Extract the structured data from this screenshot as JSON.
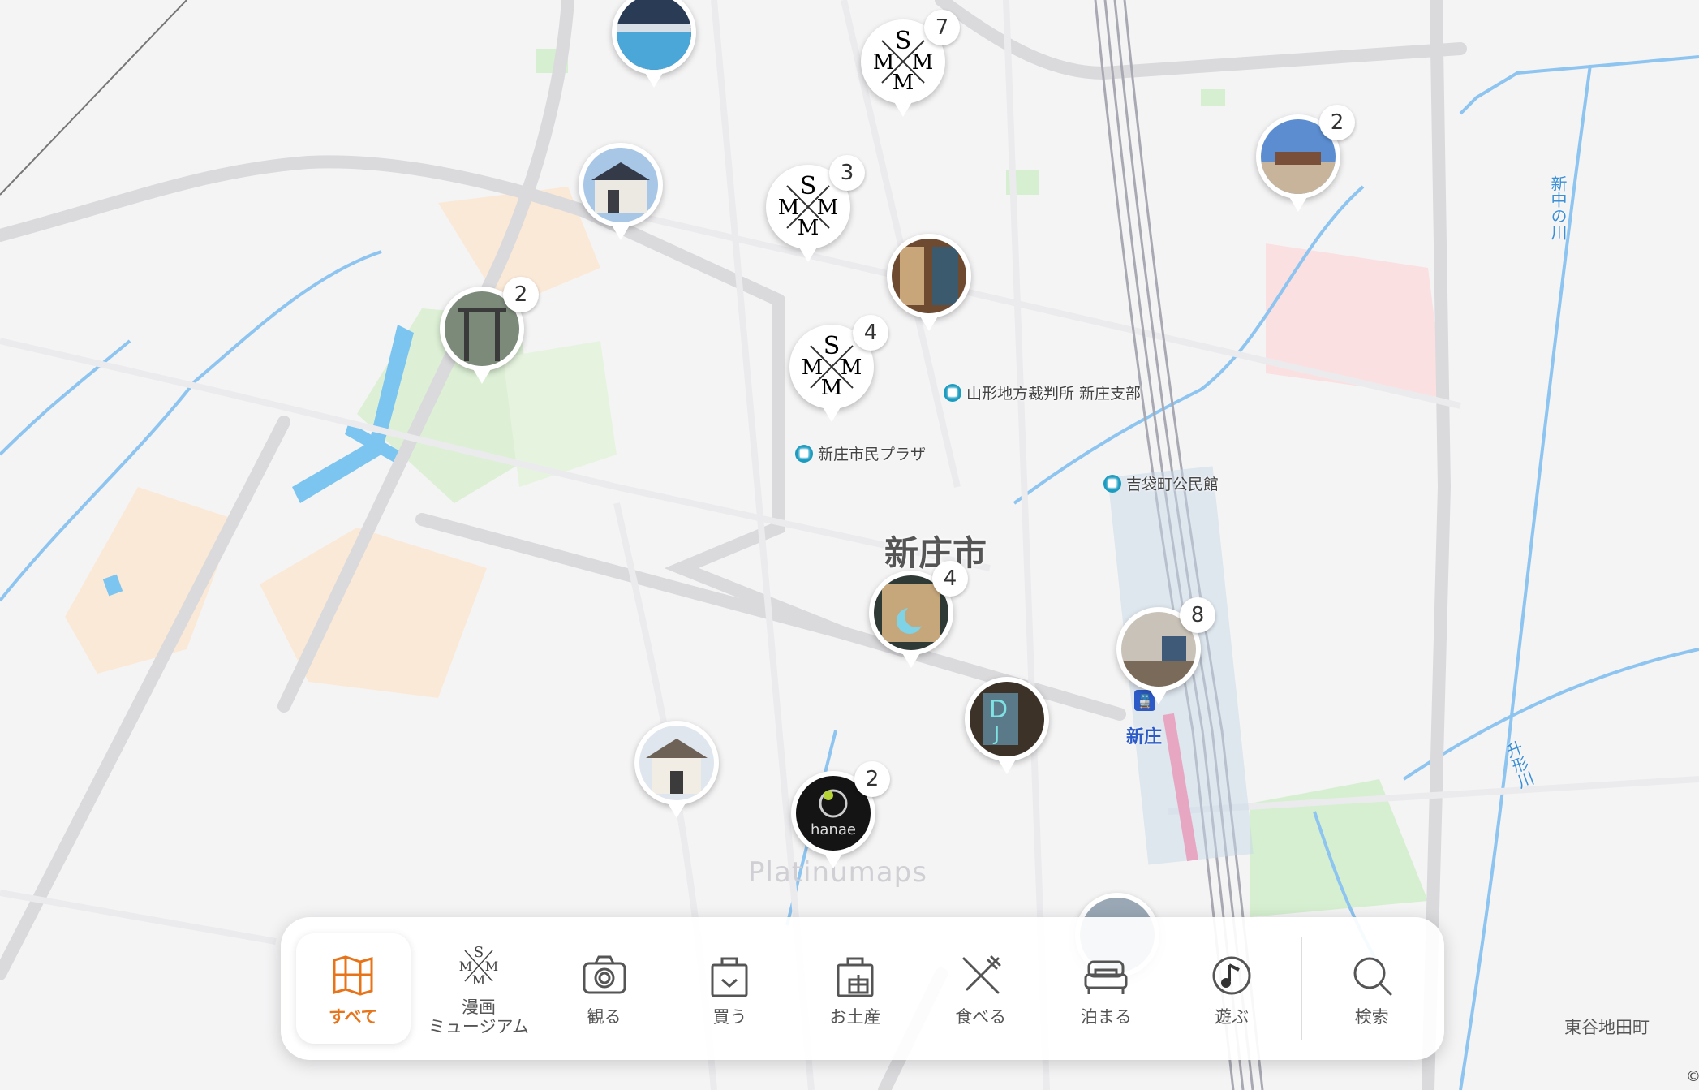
{
  "map": {
    "city_label": "新庄市",
    "station_label": "新庄",
    "station_icon": "train-icon",
    "watermark": "Platinumaps",
    "town_label": "東谷地田町",
    "copyright": "©",
    "rivers": [
      "新中の川",
      "升形川"
    ],
    "pois": [
      {
        "name": "山形地方裁判所 新庄支部",
        "icon": "public-facility-icon"
      },
      {
        "name": "新庄市民プラザ",
        "icon": "public-facility-icon"
      },
      {
        "name": "吉袋町公民館",
        "icon": "public-facility-icon"
      }
    ]
  },
  "markers": [
    {
      "kind": "photo",
      "count": "",
      "theme": "pool"
    },
    {
      "kind": "mm",
      "count": "7",
      "theme": "manga-museum"
    },
    {
      "kind": "photo",
      "count": "2",
      "theme": "building-sky"
    },
    {
      "kind": "photo",
      "count": "",
      "theme": "shop-front"
    },
    {
      "kind": "mm",
      "count": "3",
      "theme": "manga-museum"
    },
    {
      "kind": "photo",
      "count": "",
      "theme": "bookshelf-interior"
    },
    {
      "kind": "photo",
      "count": "2",
      "theme": "shrine-gate"
    },
    {
      "kind": "mm",
      "count": "4",
      "theme": "manga-museum"
    },
    {
      "kind": "photo",
      "count": "4",
      "theme": "moon-sign-shop"
    },
    {
      "kind": "photo",
      "count": "8",
      "theme": "station-interior"
    },
    {
      "kind": "photo",
      "count": "",
      "theme": "dj-sign"
    },
    {
      "kind": "photo",
      "count": "",
      "theme": "temple-building"
    },
    {
      "kind": "photo",
      "count": "2",
      "theme": "hanae-logo"
    }
  ],
  "menu": {
    "accent": "#e8741a",
    "items": [
      {
        "label": "すべて",
        "icon": "map-icon",
        "active": true
      },
      {
        "label": "漫画\nミュージアム",
        "icon": "manga-museum-icon",
        "active": false
      },
      {
        "label": "観る",
        "icon": "camera-icon",
        "active": false
      },
      {
        "label": "買う",
        "icon": "shopping-bag-icon",
        "active": false
      },
      {
        "label": "お土産",
        "icon": "gift-bag-icon",
        "active": false
      },
      {
        "label": "食べる",
        "icon": "fork-knife-icon",
        "active": false
      },
      {
        "label": "泊まる",
        "icon": "bed-icon",
        "active": false
      },
      {
        "label": "遊ぶ",
        "icon": "music-note-icon",
        "active": false
      }
    ],
    "search_label": "検索",
    "search_icon": "search-icon"
  }
}
